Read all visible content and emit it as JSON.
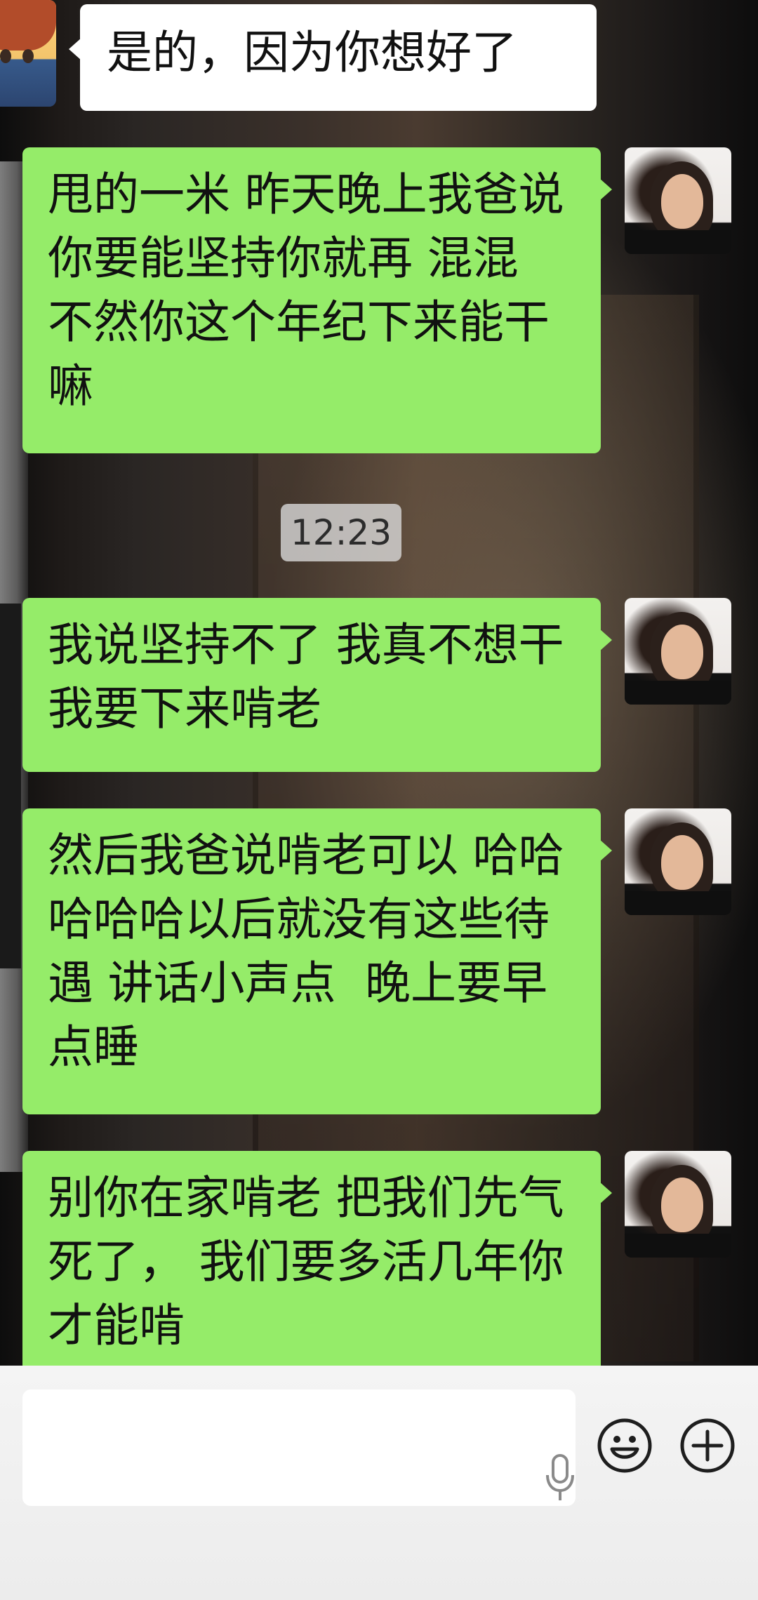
{
  "chat": {
    "messages": [
      {
        "side": "left",
        "text": "是的，因为你想好了"
      },
      {
        "side": "right",
        "text": "甩的一米 昨天晚上我爸说你要能坚持你就再 混混 不然你这个年纪下来能干嘛"
      },
      {
        "type": "time",
        "text": "12:23"
      },
      {
        "side": "right",
        "text": "我说坚持不了 我真不想干   我要下来啃老"
      },
      {
        "side": "right",
        "text": "然后我爸说啃老可以 哈哈哈哈哈以后就没有这些待遇 讲话小声点  晚上要早点睡"
      },
      {
        "side": "right",
        "text": "别你在家啃老 把我们先气死了， 我们要多活几年你才能啃"
      }
    ]
  },
  "input_bar": {
    "placeholder": "",
    "icons": [
      "voice-mic-icon",
      "emoji-smile-icon",
      "plus-more-icon"
    ]
  },
  "colors": {
    "sent_bubble": "#95ec69",
    "received_bubble": "#ffffff",
    "timestamp_bg": "#dcdcdc",
    "input_bar_bg": "#f2f2f2"
  }
}
